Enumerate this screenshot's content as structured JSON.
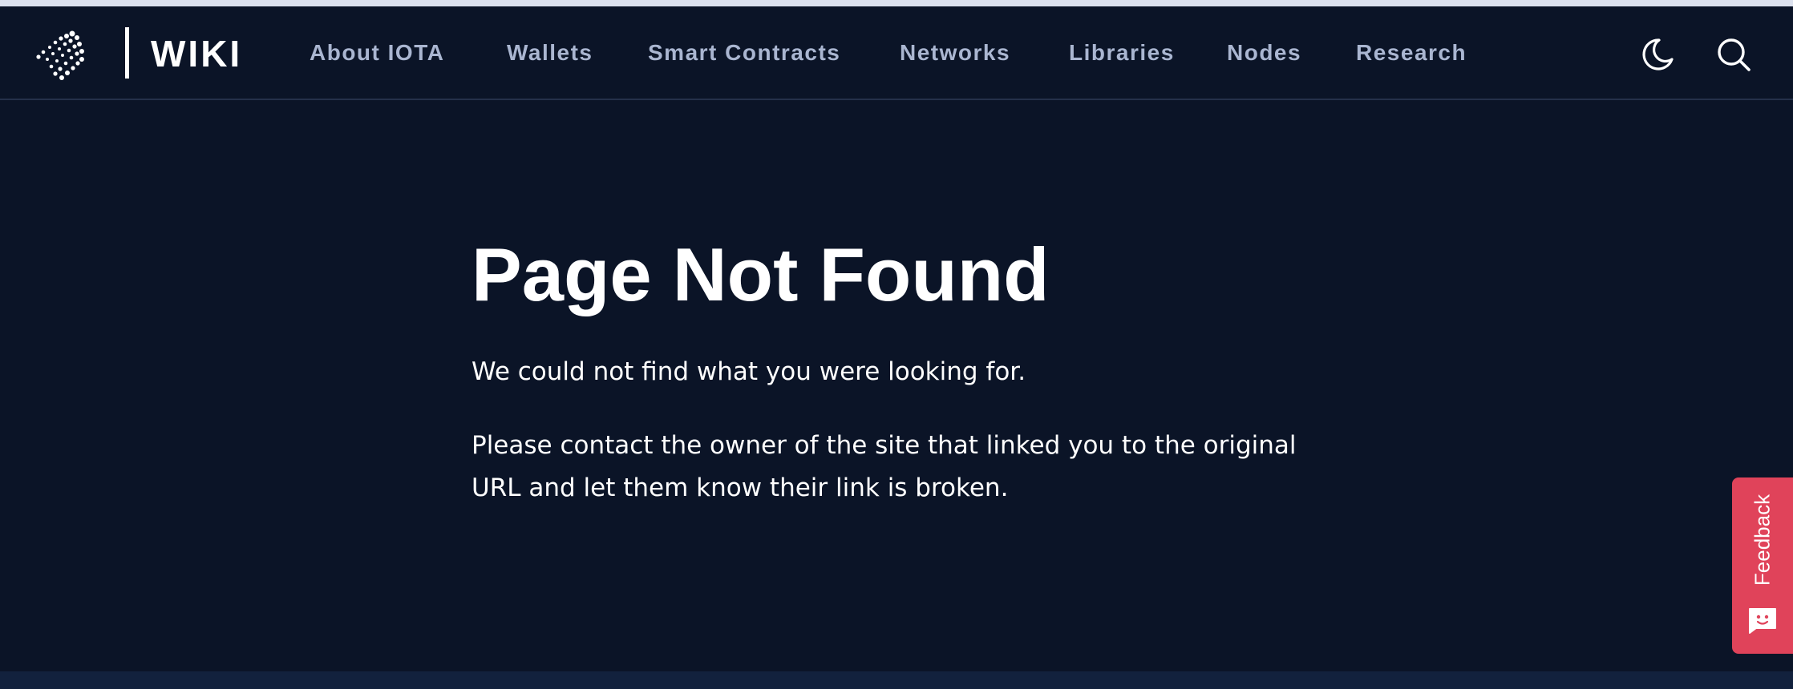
{
  "header": {
    "brand": "WIKI",
    "nav": [
      {
        "label": "About IOTA"
      },
      {
        "label": "Wallets"
      },
      {
        "label": "Smart Contracts"
      },
      {
        "label": "Networks"
      },
      {
        "label": "Libraries"
      },
      {
        "label": "Nodes"
      },
      {
        "label": "Research"
      }
    ],
    "icons": {
      "logo": "iota-logo-icon",
      "theme_toggle": "moon-icon",
      "search": "search-icon"
    }
  },
  "main": {
    "title": "Page Not Found",
    "paragraph1": "We could not find what you were looking for.",
    "paragraph2": "Please contact the owner of the site that linked you to the original URL and let them know their link is broken."
  },
  "feedback": {
    "label": "Feedback",
    "icon": "chat-face-icon",
    "color": "#e0435a"
  },
  "colors": {
    "background": "#0b1427",
    "nav_text": "#aab6d1",
    "text": "#ffffff"
  }
}
